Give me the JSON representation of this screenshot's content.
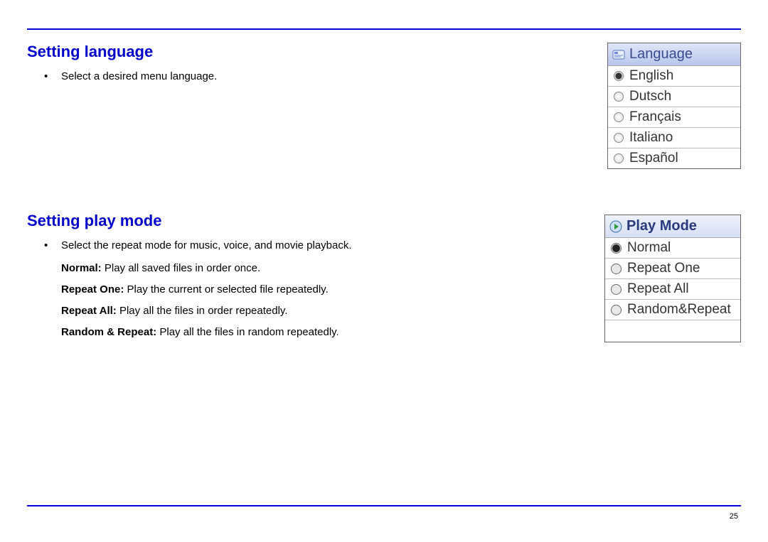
{
  "page_number": "25",
  "section_language": {
    "heading": "Setting language",
    "bullet": "Select a desired menu language.",
    "ui_title": "Language",
    "options": [
      {
        "label": "English",
        "selected": true
      },
      {
        "label": "Dutsch",
        "selected": false
      },
      {
        "label": "Français",
        "selected": false
      },
      {
        "label": "Italiano",
        "selected": false
      },
      {
        "label": "Español",
        "selected": false
      }
    ]
  },
  "section_playmode": {
    "heading": "Setting play mode",
    "bullet": "Select the repeat mode for music, voice, and movie playback.",
    "items": [
      {
        "name": "Normal:",
        "desc": " Play all saved files in order once."
      },
      {
        "name": "Repeat One:",
        "desc": " Play the current or selected file repeatedly."
      },
      {
        "name": "Repeat All:",
        "desc": " Play all the files in order repeatedly."
      },
      {
        "name": "Random & Repeat:",
        "desc": " Play all the files in random repeatedly."
      }
    ],
    "ui_title": "Play Mode",
    "options": [
      {
        "label": "Normal",
        "selected": true
      },
      {
        "label": "Repeat One",
        "selected": false
      },
      {
        "label": "Repeat All",
        "selected": false
      },
      {
        "label": "Random&Repeat",
        "selected": false
      }
    ]
  }
}
